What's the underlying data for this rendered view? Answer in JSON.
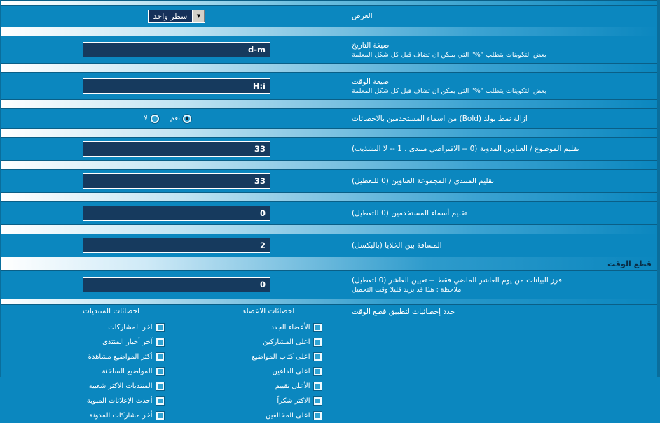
{
  "display_row": {
    "label": "العرض",
    "select": {
      "value": "سطر واحد",
      "arrow": "▼"
    }
  },
  "rows": [
    {
      "label": "صيغة التاريخ",
      "sub": "بعض التكوينات يتطلب \"%\" التي يمكن ان تضاف قبل كل شكل المعلمة",
      "value": "d-m"
    },
    {
      "label": "صيغة الوقت",
      "sub": "بعض التكوينات يتطلب \"%\" التي يمكن ان تضاف قبل كل شكل المعلمة",
      "value": "H:i"
    },
    {
      "label": "تقليم الموضوع / العناوين المدونة (0 -- الافتراضي منتدى ، 1 -- لا التشذيب)",
      "sub": "",
      "value": "33"
    },
    {
      "label": "تقليم المنتدى / المجموعة العناوين (0 للتعطيل)",
      "sub": "",
      "value": "33"
    },
    {
      "label": "تقليم أسماء المستخدمين (0 للتعطيل)",
      "sub": "",
      "value": "0"
    },
    {
      "label": "المسافة بين الخلايا (بالبكسل)",
      "sub": "",
      "value": "2"
    }
  ],
  "bold_row": {
    "label": "ازالة نمط بولد (Bold) من اسماء المستخدمين بالاحصائات",
    "options": [
      {
        "label": "نعم",
        "selected": true
      },
      {
        "label": "لا",
        "selected": false
      }
    ]
  },
  "time_section": {
    "title": "قطع الوقت",
    "cutoff_row": {
      "label": "فرز البيانات من يوم العاشر الماضي فقط -- تعيين العاشر (0 لتعطيل)",
      "sub": "ملاحظة : هذا قد يزيد قليلا وقت التحميل",
      "value": "0"
    },
    "stats_label": "حدد إحصائيات لتطبيق قطع الوقت",
    "columns": [
      {
        "head": "احصائات المنتديات",
        "items": [
          {
            "label": "اخر المشاركات",
            "checked": false
          },
          {
            "label": "آخر أخبار المنتدى",
            "checked": false
          },
          {
            "label": "أكثر المواضيع مشاهدة",
            "checked": false
          },
          {
            "label": "المواضيع الساخنة",
            "checked": false
          },
          {
            "label": "المنتديات الاكثر شعبية",
            "checked": false
          },
          {
            "label": "أحدث الإعلانات المبوبة",
            "checked": false
          },
          {
            "label": "أخر مشاركات المدونة",
            "checked": false
          }
        ]
      },
      {
        "head": "احصائات الاعضاء",
        "items": [
          {
            "label": "الأعضاء الجدد",
            "checked": false
          },
          {
            "label": "اعلى المشاركين",
            "checked": false
          },
          {
            "label": "اعلى كتاب المواضيع",
            "checked": false
          },
          {
            "label": "اعلى الداعين",
            "checked": false
          },
          {
            "label": "الأعلى تقييم",
            "checked": false
          },
          {
            "label": "الاكثر شكراً",
            "checked": false
          },
          {
            "label": "اعلى المخالفين",
            "checked": false
          }
        ]
      }
    ]
  },
  "colors": {
    "page_bg": "#0b87bf",
    "input_bg": "#163a5e",
    "header_text": "#0a2c44"
  }
}
